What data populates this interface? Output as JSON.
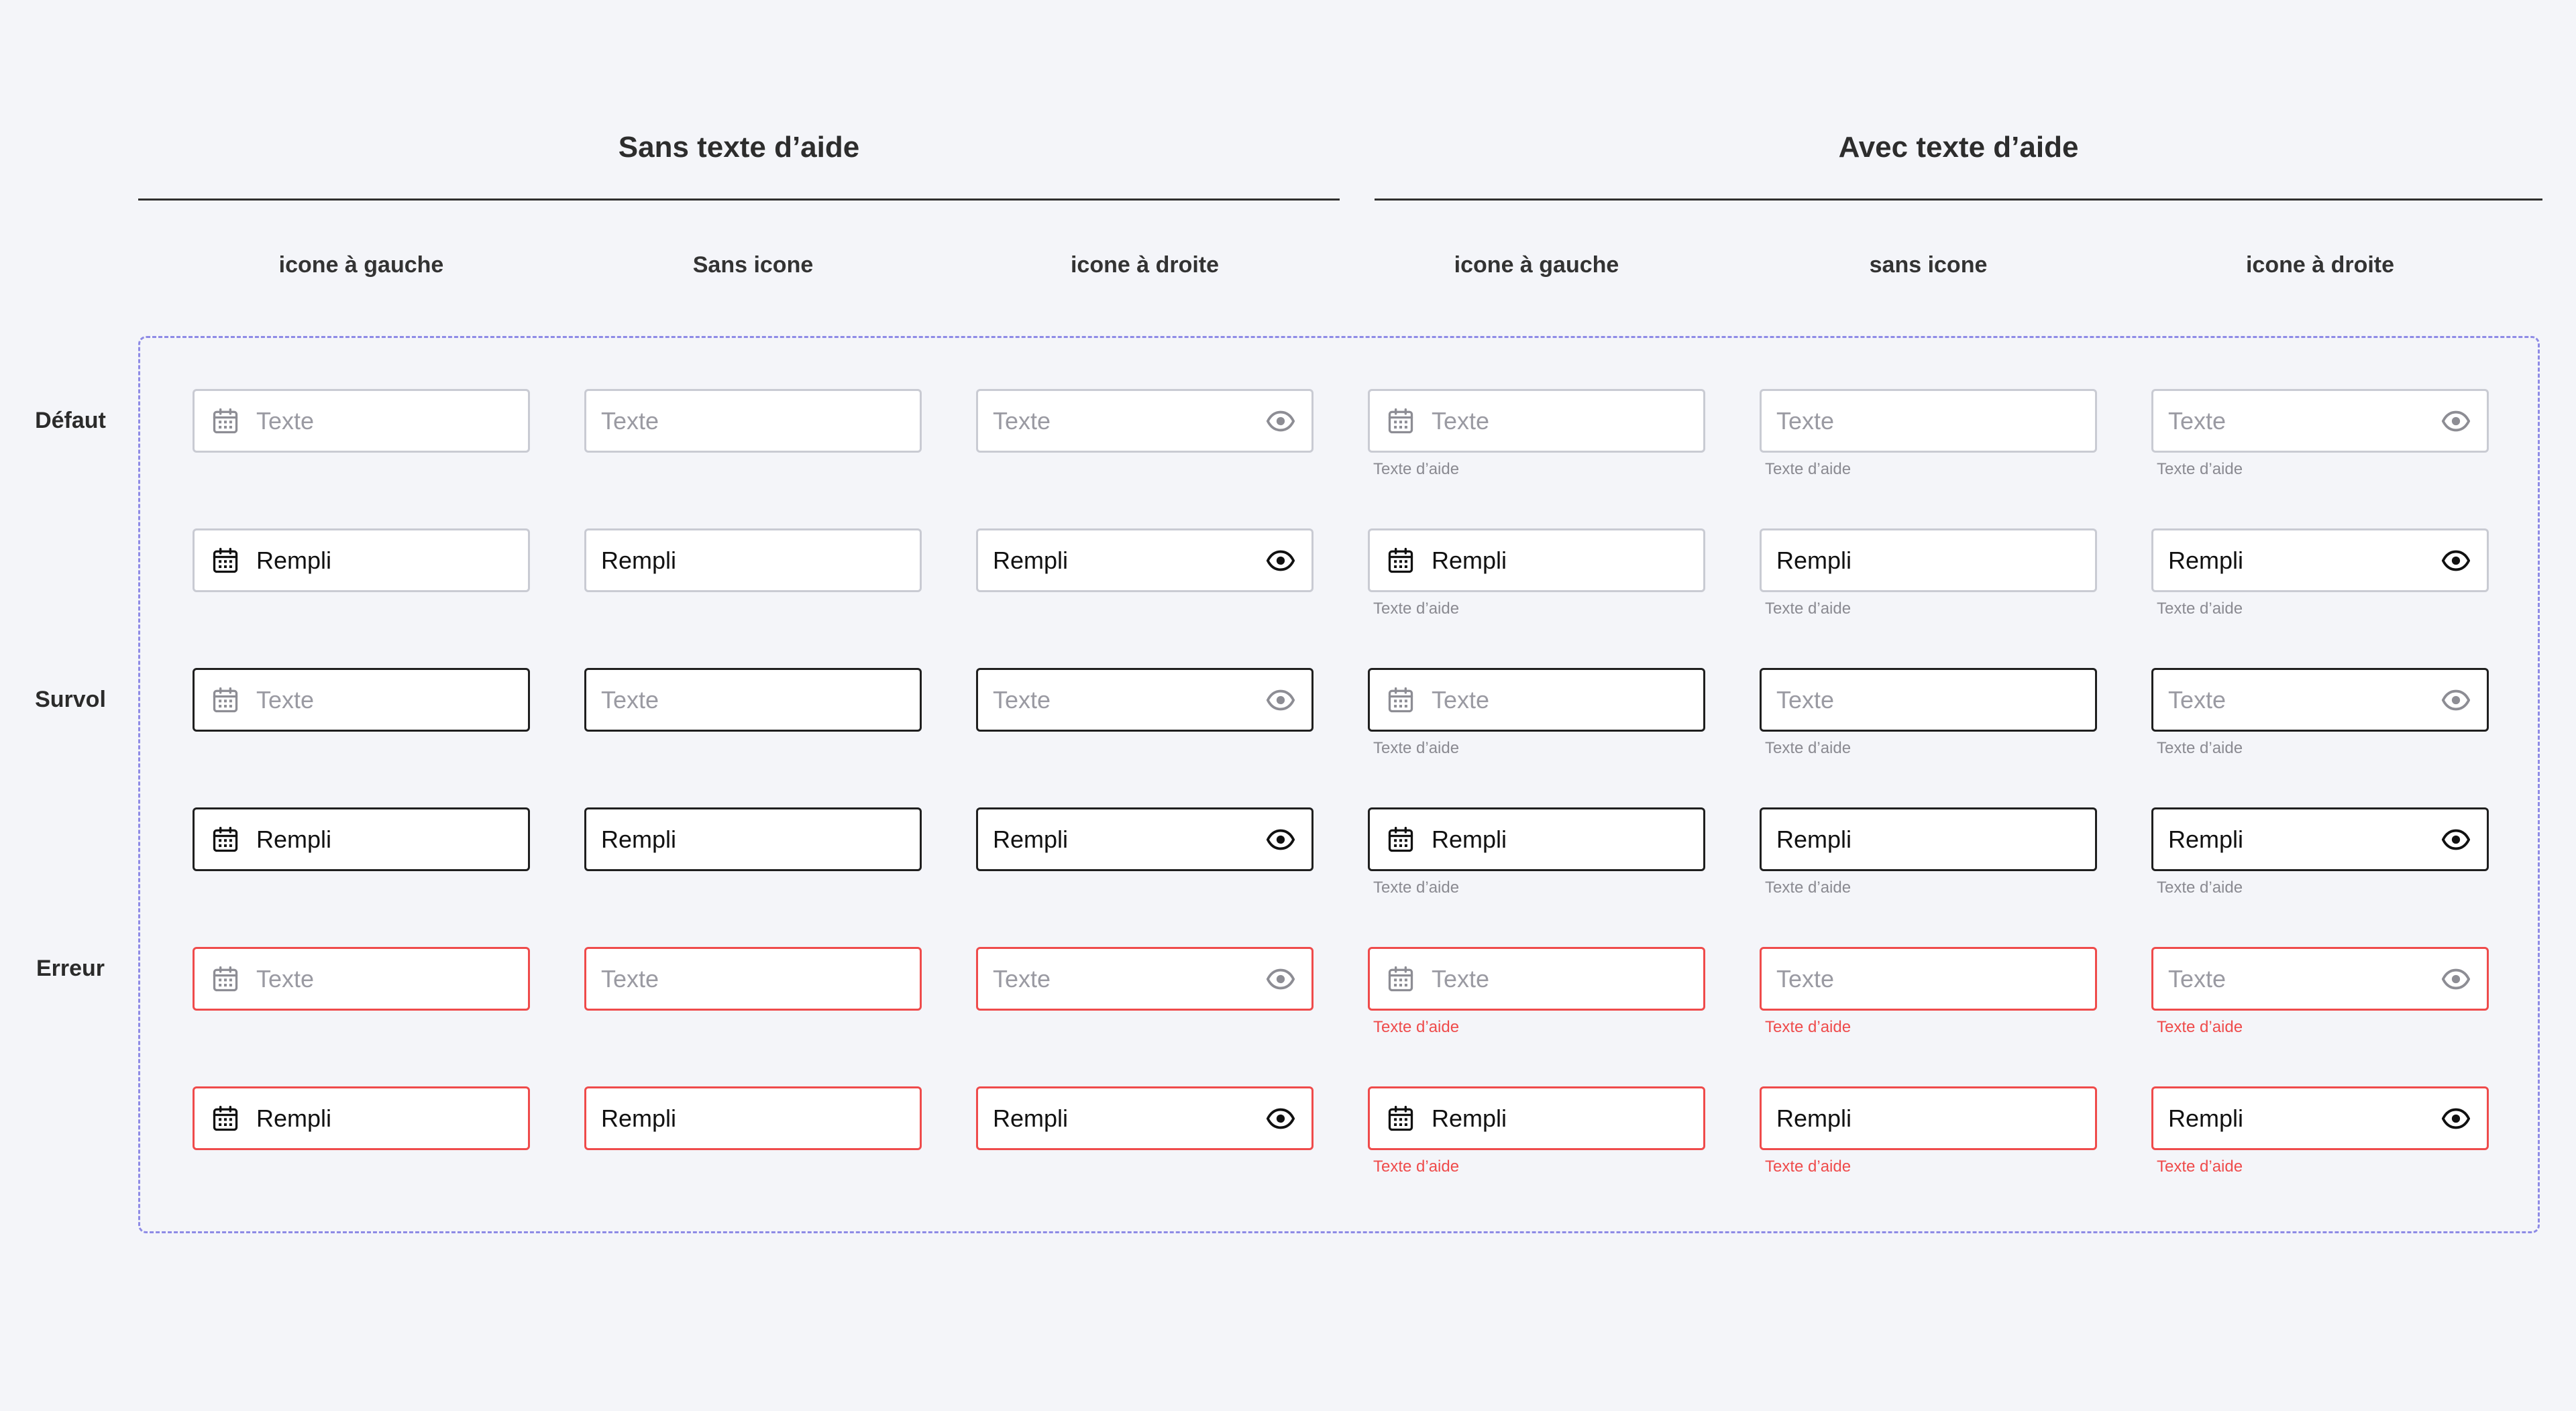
{
  "groups": [
    {
      "title": "Sans texte d’aide"
    },
    {
      "title": "Avec texte d’aide"
    }
  ],
  "columns": [
    {
      "title": "icone à gauche",
      "icon": "left",
      "helper": false
    },
    {
      "title": "Sans icone",
      "icon": "none",
      "helper": false
    },
    {
      "title": "icone à droite",
      "icon": "right",
      "helper": false
    },
    {
      "title": "icone à gauche",
      "icon": "left",
      "helper": true
    },
    {
      "title": "sans icone",
      "icon": "none",
      "helper": true
    },
    {
      "title": "icone à droite",
      "icon": "right",
      "helper": true
    }
  ],
  "states": [
    {
      "label": "Défaut",
      "key": "default"
    },
    {
      "label": "Survol",
      "key": "hover"
    },
    {
      "label": "Erreur",
      "key": "error"
    }
  ],
  "field": {
    "placeholder": "Texte",
    "filled_value": "Rempli",
    "helper_text": "Texte d’aide",
    "left_icon": "calendar-icon",
    "right_icon": "eye-icon"
  },
  "colors": {
    "default_border": "#c9cbd3",
    "hover_border": "#1f1f1f",
    "error": "#ef4b4b",
    "frame_dash": "#8e8be6",
    "background": "#f4f5f9"
  }
}
